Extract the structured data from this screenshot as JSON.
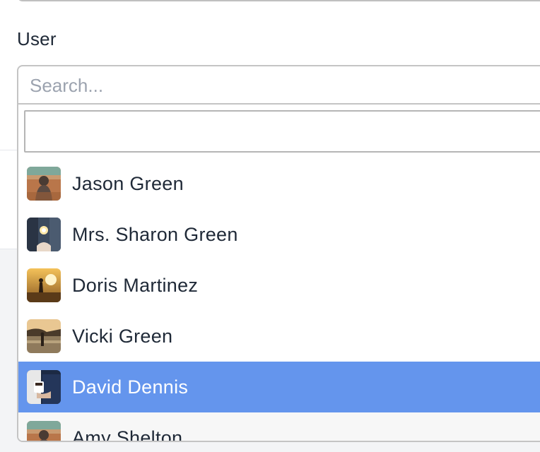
{
  "form": {
    "user_label": "User",
    "search_placeholder": "Search...",
    "filter_value": ""
  },
  "options": [
    {
      "label": "Jason Green",
      "avatar": "desert-person-photo",
      "selected": false
    },
    {
      "label": "Mrs. Sharon Green",
      "avatar": "sparkler-hands-photo",
      "selected": false
    },
    {
      "label": "Doris Martinez",
      "avatar": "sunset-runner-photo",
      "selected": false
    },
    {
      "label": "Vicki Green",
      "avatar": "beach-walker-photo",
      "selected": false
    },
    {
      "label": "David Dennis",
      "avatar": "coffee-cup-photo",
      "selected": true
    },
    {
      "label": "Amy Shelton",
      "avatar": "desert-person-photo",
      "selected": false
    }
  ],
  "colors": {
    "selected_bg": "#6495ed",
    "text": "#1f2937",
    "placeholder": "#9ca3af",
    "border": "#c4c4c4"
  }
}
